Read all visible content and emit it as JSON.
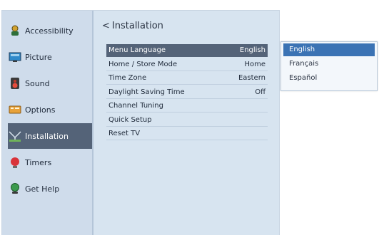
{
  "colors": {
    "frame_bg": "#d7e4f0",
    "sidebar_bg": "#cfdceb",
    "highlight": "#546378",
    "dropdown_highlight": "#3b73b4"
  },
  "sidebar": {
    "items": [
      {
        "label": "Accessibility",
        "icon": "accessibility-icon",
        "active": false
      },
      {
        "label": "Picture",
        "icon": "picture-icon",
        "active": false
      },
      {
        "label": "Sound",
        "icon": "sound-icon",
        "active": false
      },
      {
        "label": "Options",
        "icon": "options-icon",
        "active": false
      },
      {
        "label": "Installation",
        "icon": "installation-icon",
        "active": true
      },
      {
        "label": "Timers",
        "icon": "timers-icon",
        "active": false
      },
      {
        "label": "Get Help",
        "icon": "help-icon",
        "active": false
      }
    ]
  },
  "main": {
    "back_glyph": "<",
    "title": "Installation",
    "menu": [
      {
        "label": "Menu Language",
        "value": "English",
        "selected": true
      },
      {
        "label": "Home / Store Mode",
        "value": "Home",
        "selected": false
      },
      {
        "label": "Time Zone",
        "value": "Eastern",
        "selected": false
      },
      {
        "label": "Daylight Saving Time",
        "value": "Off",
        "selected": false
      },
      {
        "label": "Channel Tuning",
        "value": "",
        "selected": false
      },
      {
        "label": "Quick Setup",
        "value": "",
        "selected": false
      },
      {
        "label": "Reset TV",
        "value": "",
        "selected": false
      }
    ]
  },
  "dropdown": {
    "options": [
      {
        "label": "English",
        "selected": true
      },
      {
        "label": "Français",
        "selected": false
      },
      {
        "label": "Español",
        "selected": false
      }
    ]
  }
}
